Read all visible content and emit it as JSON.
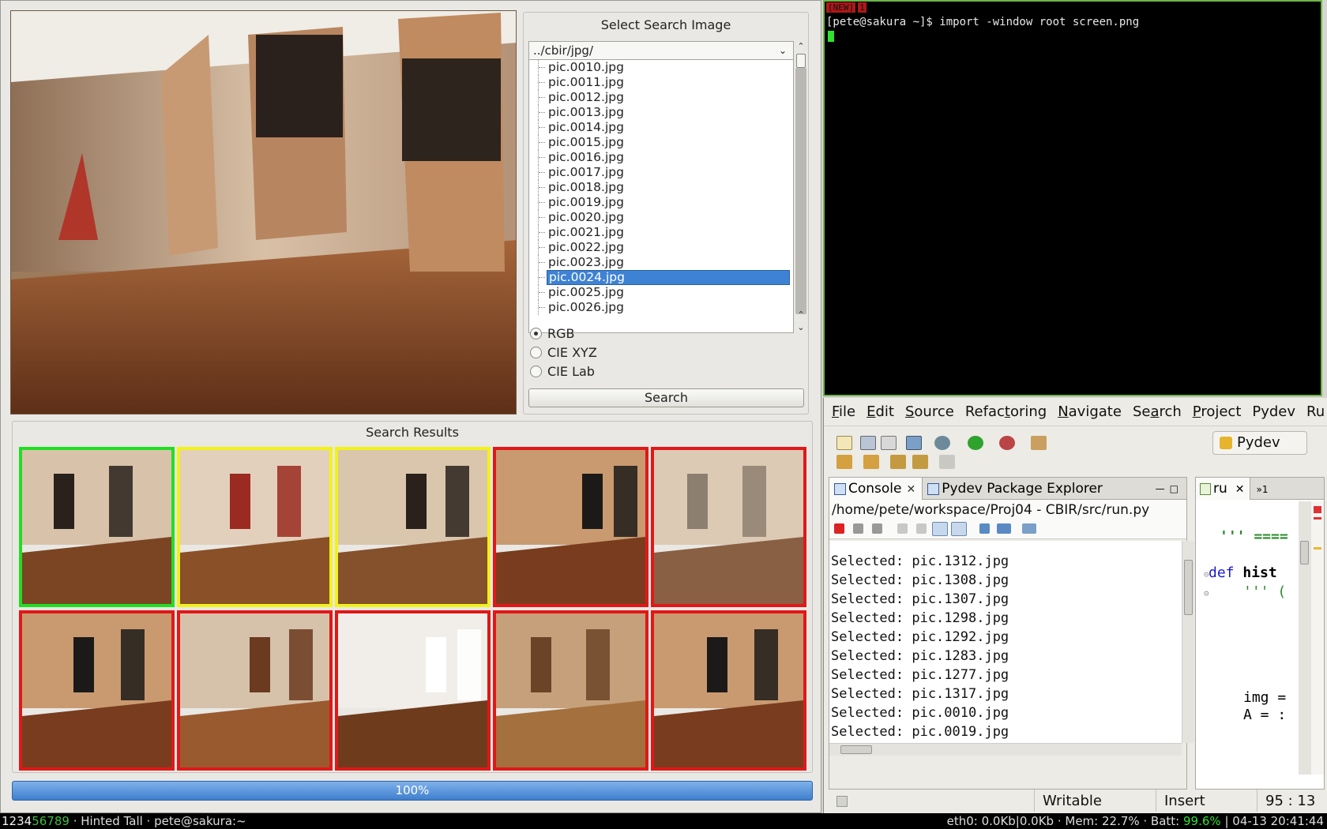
{
  "cbir": {
    "select_title": "Select Search Image",
    "directory": "../cbir/jpg/",
    "files": [
      "pic.0010.jpg",
      "pic.0011.jpg",
      "pic.0012.jpg",
      "pic.0013.jpg",
      "pic.0014.jpg",
      "pic.0015.jpg",
      "pic.0016.jpg",
      "pic.0017.jpg",
      "pic.0018.jpg",
      "pic.0019.jpg",
      "pic.0020.jpg",
      "pic.0021.jpg",
      "pic.0022.jpg",
      "pic.0023.jpg",
      "pic.0024.jpg",
      "pic.0025.jpg",
      "pic.0026.jpg"
    ],
    "selected_file": "pic.0024.jpg",
    "color_spaces": [
      {
        "label": "RGB",
        "checked": true
      },
      {
        "label": "CIE XYZ",
        "checked": false
      },
      {
        "label": "CIE Lab",
        "checked": false
      }
    ],
    "search_label": "Search",
    "results_title": "Search Results",
    "result_frames": [
      "green",
      "yellow",
      "yellow",
      "red",
      "red",
      "red",
      "red",
      "red",
      "red",
      "red"
    ],
    "frame_colors": {
      "green": "#22dd22",
      "yellow": "#f2f21a",
      "red": "#e01818"
    },
    "progress_label": "100%",
    "progress_value": 1.0
  },
  "terminal": {
    "tabs": [
      "[NEW]",
      "1"
    ],
    "line": "[pete@sakura ~]$ import -window root screen.png"
  },
  "eclipse": {
    "menu": [
      {
        "u": "F",
        "rest": "ile"
      },
      {
        "u": "E",
        "rest": "dit"
      },
      {
        "u": "S",
        "rest": "ource"
      },
      {
        "u": "",
        "rest": "Refac",
        "u2": "t",
        "rest2": "oring"
      },
      {
        "u": "N",
        "rest": "avigate"
      },
      {
        "u": "",
        "rest": "Se",
        "u2": "a",
        "rest2": "rch"
      },
      {
        "u": "P",
        "rest": "roject"
      },
      {
        "u": "",
        "rest": "Pydev"
      },
      {
        "u": "",
        "rest": "Ru"
      }
    ],
    "perspective": "Pydev",
    "console_tab": "Console",
    "explorer_tab": "Pydev Package Explorer",
    "console_path": "/home/pete/workspace/Proj04 - CBIR/src/run.py",
    "console_lines": [
      "Selected: pic.1312.jpg",
      "Selected: pic.1308.jpg",
      "Selected: pic.1307.jpg",
      "Selected: pic.1298.jpg",
      "Selected: pic.1292.jpg",
      "Selected: pic.1283.jpg",
      "Selected: pic.1277.jpg",
      "Selected: pic.1317.jpg",
      "Selected: pic.0010.jpg",
      "Selected: pic.0019.jpg"
    ],
    "editor_tab": "ru",
    "editor_more": "»1",
    "code": {
      "docstring_start": "''' ====",
      "def_kw": "def",
      "def_name": " hist",
      "doc2": "''' (",
      "line_img": "img =",
      "line_a": "A = :"
    },
    "status": {
      "writable": "Writable",
      "mode": "Insert",
      "position": "95 : 13"
    },
    "colors": {
      "keyword": "#1a1acc",
      "docstring": "#2a8a2a"
    }
  },
  "statusbar": {
    "ws_active": "1234",
    "ws_inactive": "56789",
    "layout": "· Hinted Tall · pete@sakura:~",
    "net": "eth0: 0.0Kb|0.0Kb · Mem: 22.7% · Batt: ",
    "batt": "99.6%",
    "clock": "| 04-13 20:41:44"
  }
}
